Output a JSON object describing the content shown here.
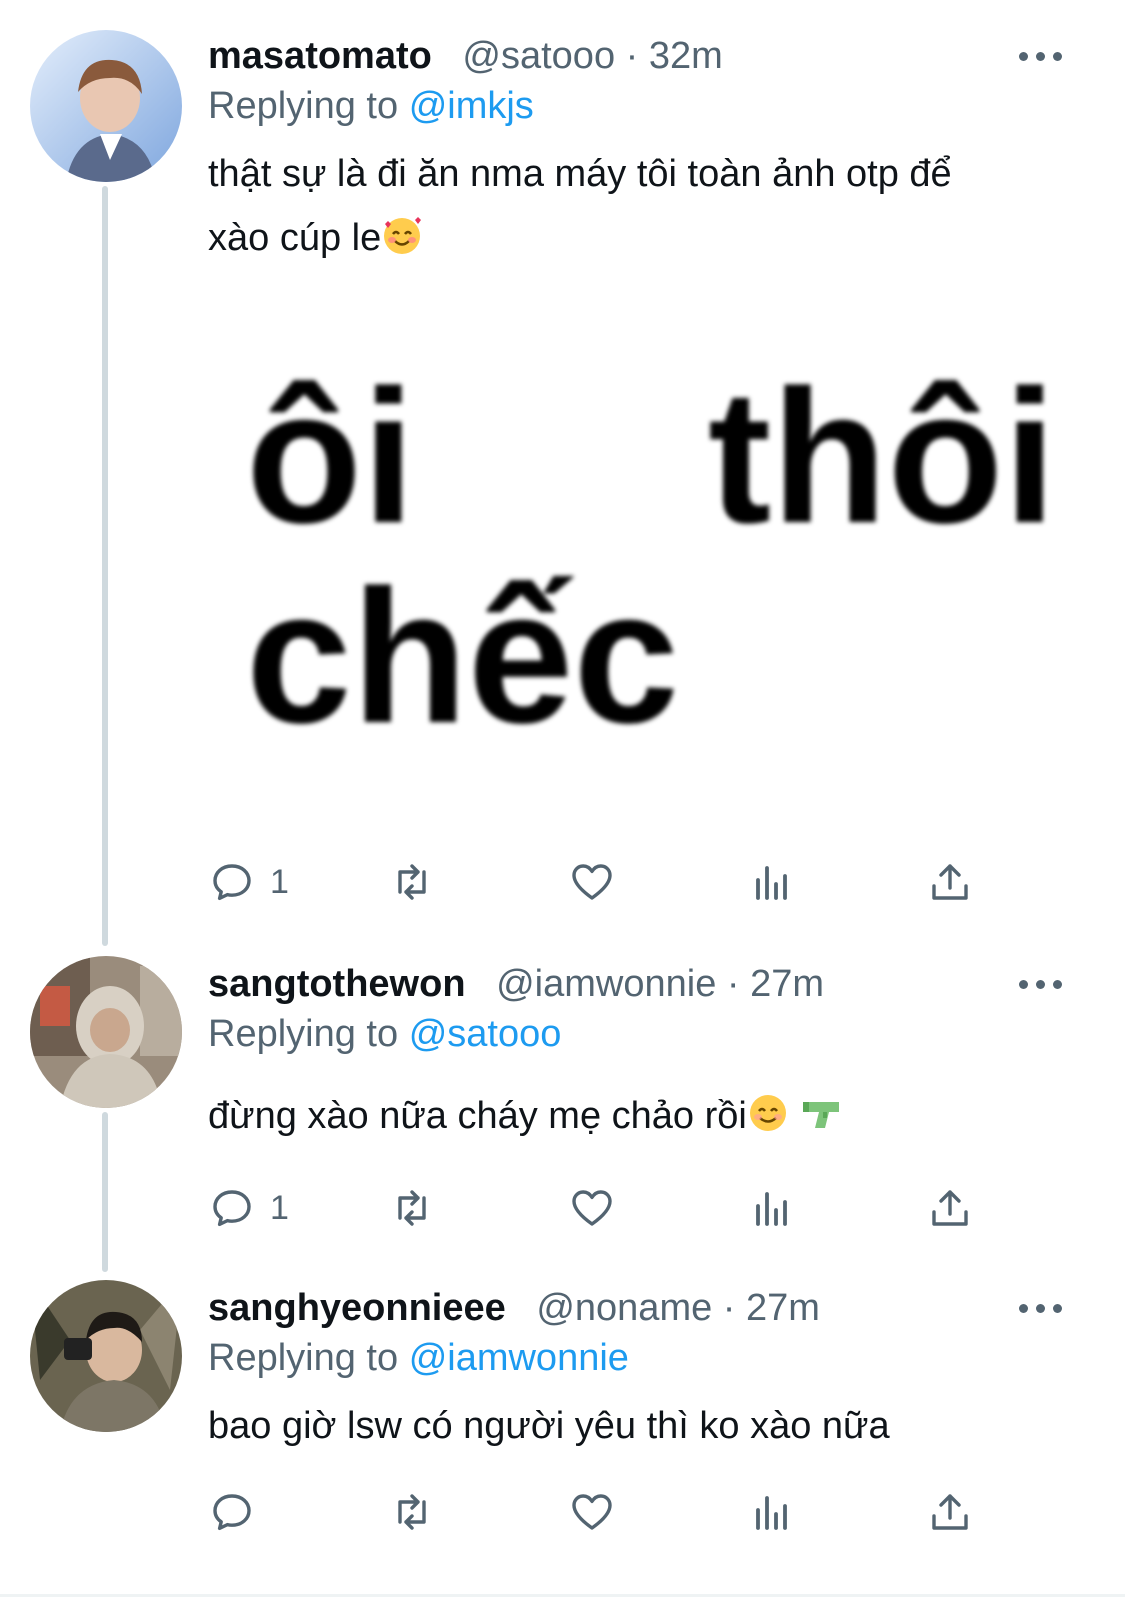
{
  "tweets": [
    {
      "name": "masatomato",
      "handle": "@satooo",
      "dot": "·",
      "time": "32m",
      "replying_prefix": "Replying to",
      "replying_mention": "@imkjs",
      "text_line1": "thật sự là đi ăn nma máy tôi toàn ảnh otp để",
      "text_line2": "xào cúp le",
      "emoji": "smiling-face-with-hearts",
      "media_text": {
        "w1": "ôi",
        "w2": "thôi",
        "w3": "chếc"
      },
      "reply_count": "1",
      "avatar_colors": [
        "#c6dcf5",
        "#8fb4e6"
      ]
    },
    {
      "name": "sangtothewon",
      "handle": "@iamwonnie",
      "dot": "·",
      "time": "27m",
      "replying_prefix": "Replying to",
      "replying_mention": "@satooo",
      "text_line1": "đừng xào nữa cháy mẹ chảo rồi",
      "emoji": "smiling-face, water-pistol",
      "reply_count": "1",
      "avatar_colors": [
        "#8a7a6a",
        "#d8d0c4"
      ]
    },
    {
      "name": "sanghyeonnieee",
      "handle": "@noname",
      "dot": "·",
      "time": "27m",
      "replying_prefix": "Replying to",
      "replying_mention": "@iamwonnie",
      "text_line1": "bao giờ lsw có người yêu thì ko xào nữa",
      "reply_count": "",
      "avatar_colors": [
        "#3c3a2e",
        "#a69c84"
      ]
    }
  ],
  "colors": {
    "mention": "#1d9bf0",
    "secondary_text": "#536471",
    "thread_line": "#cfd9de"
  },
  "action_icons": [
    "reply-icon",
    "retweet-icon",
    "like-icon",
    "analytics-icon",
    "share-icon"
  ]
}
